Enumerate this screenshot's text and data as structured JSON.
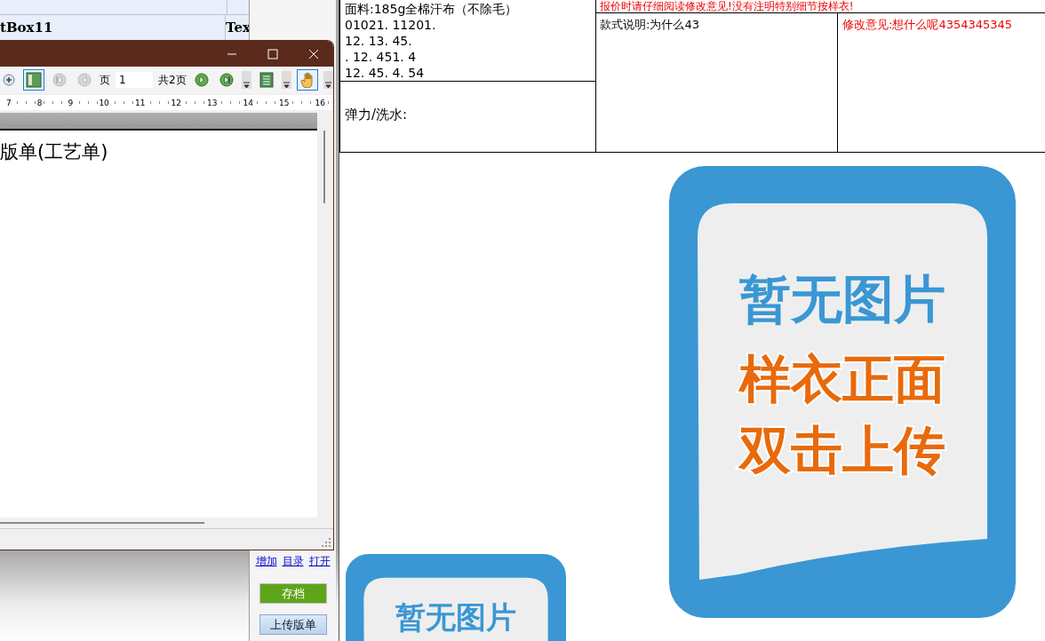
{
  "background_table": {
    "rows": [
      {
        "cells": [
          "tBox11",
          "Tex"
        ]
      }
    ]
  },
  "viewer_window": {
    "tools": [
      {
        "kind": "zoom"
      },
      {
        "kind": "layout",
        "selected": true
      },
      {
        "kind": "first",
        "disabled": true
      },
      {
        "kind": "prev",
        "disabled": true
      },
      {
        "kind": "pager"
      },
      {
        "kind": "next",
        "disabled": false
      },
      {
        "kind": "last",
        "disabled": false
      },
      {
        "kind": "dropdown"
      },
      {
        "kind": "page"
      },
      {
        "kind": "dropdown"
      },
      {
        "kind": "hand",
        "selected": true
      },
      {
        "kind": "dropdown"
      }
    ],
    "page_label": "页",
    "page_value": "1",
    "page_total": "共2页",
    "ruler": [
      "7",
      "8",
      "9",
      "10",
      "11",
      "12",
      "13",
      "14",
      "15",
      "16"
    ],
    "document_title": "版单(工艺单)"
  },
  "side_panel": {
    "links": [
      "增加",
      "目录",
      "打开"
    ],
    "buttons": [
      {
        "label": "存档",
        "kind": "primary"
      },
      {
        "label": "上传版单",
        "kind": "secondary"
      }
    ]
  },
  "sheet": {
    "fabric_lines": [
      "面料:185g全棉汗布（不除毛）",
      "01021. 11201.",
      "12. 13. 45.",
      ". 12. 451. 4",
      "12. 45. 4. 54"
    ],
    "notice": "报价时请仔细阅读修改意见!没有注明特别细节按样衣!",
    "elastic_wash": "弹力/洗水:",
    "style_note": "款式说明:为什么43",
    "revision_note": "修改意见:想什么呢4354345345"
  },
  "photo_slots": [
    {
      "kind": "small",
      "lines": [
        "暂无图片"
      ]
    },
    {
      "kind": "large",
      "lines": [
        "暂无图片",
        "样衣正面",
        "双击上传"
      ]
    }
  ]
}
